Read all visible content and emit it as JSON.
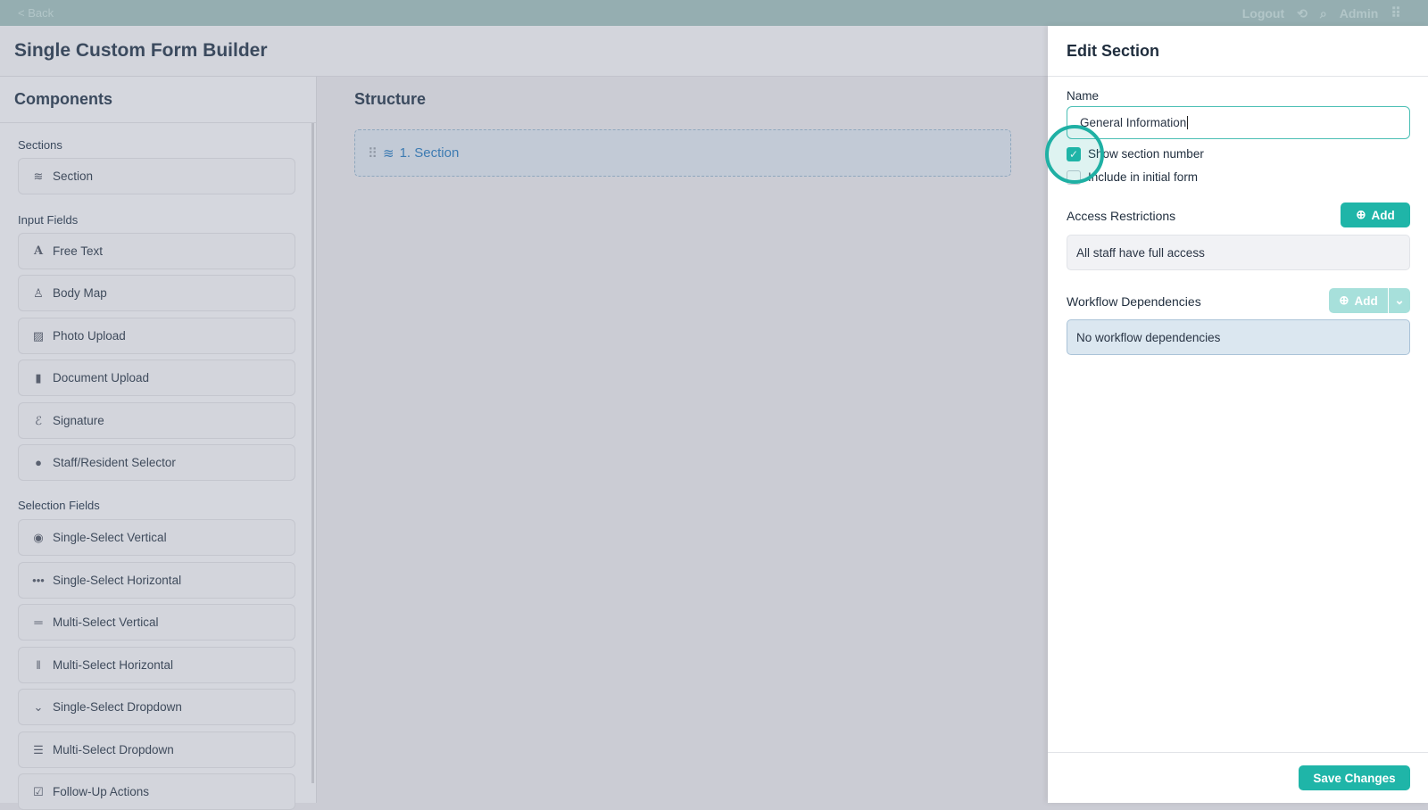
{
  "topbar": {
    "back": "< Back",
    "logout": "Logout",
    "user": "Admin"
  },
  "header": {
    "title": "Single Custom Form Builder"
  },
  "components": {
    "title": "Components",
    "groups": {
      "sections": "Sections",
      "input": "Input Fields",
      "selection": "Selection Fields"
    },
    "items": [
      "Section",
      "Free Text",
      "Body Map",
      "Photo Upload",
      "Document Upload",
      "Signature",
      "Staff/Resident Selector",
      "Single-Select Vertical",
      "Single-Select Horizontal",
      "Multi-Select Vertical",
      "Multi-Select Horizontal",
      "Single-Select Dropdown",
      "Multi-Select Dropdown",
      "Follow-Up Actions"
    ]
  },
  "structure": {
    "title": "Structure",
    "section": "1. Section"
  },
  "edit": {
    "title": "Edit Section",
    "name_label": "Name",
    "name_value": "General Information",
    "show_number": "Show section number",
    "show_number_checked": true,
    "include_initial": "Include in initial form",
    "include_initial_checked": false,
    "access_label": "Access Restrictions",
    "access_add": "Add",
    "access_value": "All staff have full access",
    "workflow_label": "Workflow Dependencies",
    "workflow_add": "Add",
    "workflow_value": "No workflow dependencies",
    "save": "Save Changes"
  },
  "colors": {
    "accent": "#1fb5a8"
  }
}
